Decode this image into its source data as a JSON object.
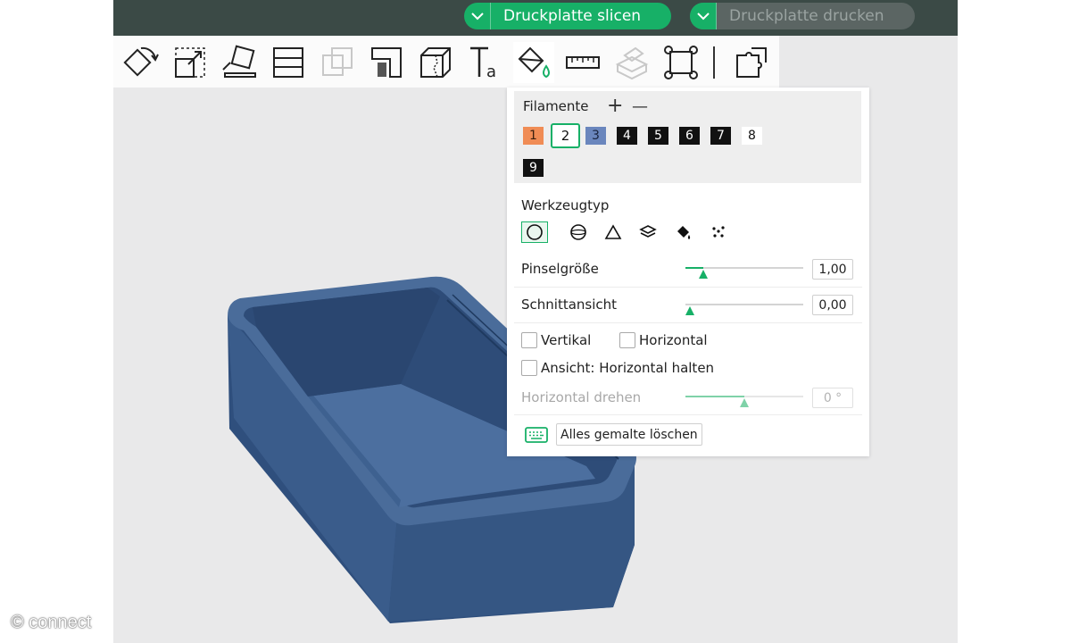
{
  "topbar": {
    "slice_label": "Druckplatte slicen",
    "print_label": "Druckplatte drucken"
  },
  "toolbar": {
    "tools": [
      "move-rotate",
      "scale",
      "lay-on-face",
      "cut",
      "boolean",
      "support-paint",
      "seam-paint",
      "text",
      "color-paint",
      "measure",
      "assembly",
      "auto-orient",
      "split"
    ],
    "active_tool": "color-paint"
  },
  "panel": {
    "filaments_title": "Filamente",
    "add_symbol": "+",
    "remove_symbol": "—",
    "filaments": [
      {
        "label": "1",
        "color": "#f08c55",
        "text_color": "#3a1f0f"
      },
      {
        "label": "2",
        "color": "#ffffff",
        "text_color": "#111111",
        "selected": true
      },
      {
        "label": "3",
        "color": "#6a86bd",
        "text_color": "#18243f"
      },
      {
        "label": "4",
        "color": "#111111",
        "text_color": "#ffffff"
      },
      {
        "label": "5",
        "color": "#111111",
        "text_color": "#ffffff"
      },
      {
        "label": "6",
        "color": "#111111",
        "text_color": "#ffffff"
      },
      {
        "label": "7",
        "color": "#111111",
        "text_color": "#ffffff"
      },
      {
        "label": "8",
        "color": "#ffffff",
        "text_color": "#111111"
      },
      {
        "label": "9",
        "color": "#111111",
        "text_color": "#ffffff"
      }
    ],
    "tooltype_title": "Werkzeugtyp",
    "tooltypes": [
      "circle",
      "sphere",
      "triangle",
      "height-range",
      "fill",
      "gap-fill"
    ],
    "active_tooltype": "circle",
    "brush_size": {
      "label": "Pinselgröße",
      "value": "1,00",
      "level": 0.15
    },
    "section_view": {
      "label": "Schnittansicht",
      "value": "0,00",
      "level": 0.0
    },
    "vertical_label": "Vertikal",
    "horizontal_label": "Horizontal",
    "keep_horizontal_label": "Ansicht: Horizontal halten",
    "rotate_horizontal": {
      "label": "Horizontal drehen",
      "value": "0 °",
      "level": 0.5
    },
    "clear_label": "Alles gemalte löschen"
  },
  "watermark": "© connect",
  "colors": {
    "accent": "#17b067",
    "topbar": "#3b4a46",
    "model": "#3b5d8a"
  }
}
